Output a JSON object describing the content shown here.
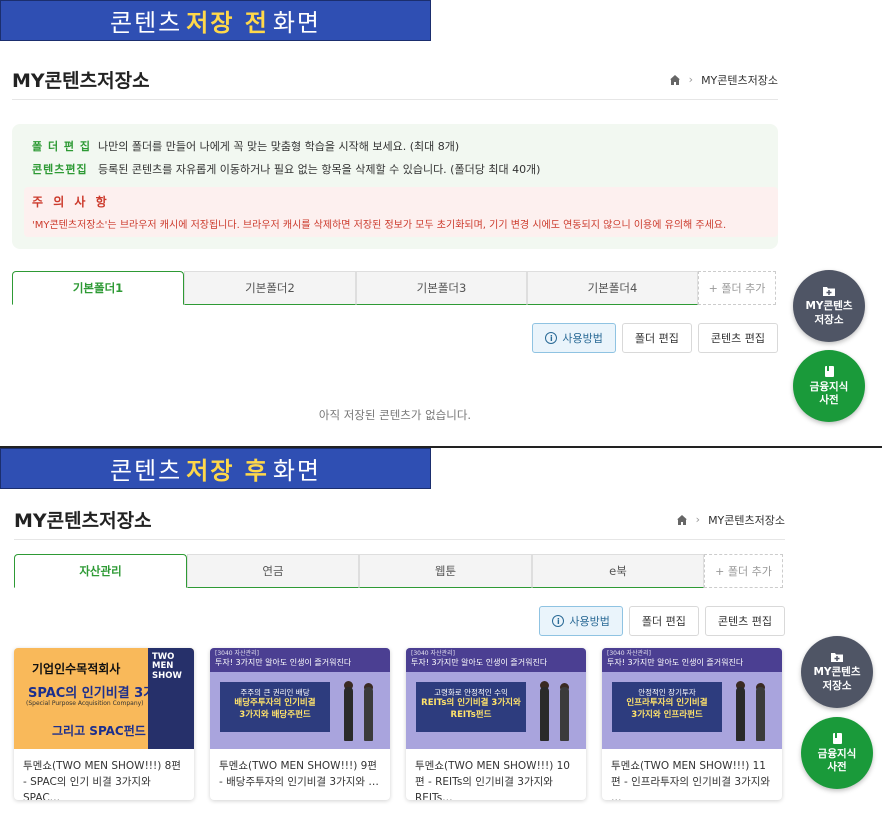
{
  "banners": {
    "top": {
      "pre": "콘텐츠",
      "highlight": "저장 전",
      "post": "화면"
    },
    "bottom": {
      "pre": "콘텐츠",
      "highlight": "저장 후",
      "post": "화면"
    }
  },
  "colors": {
    "banner_bg": "#2f4fb3",
    "banner_highlight": "#ffd84a",
    "accent_green": "#2e9a35",
    "caution_red": "#cc3a2c",
    "fab_dark": "#4f5565",
    "fab_green": "#1a9a3a"
  },
  "before": {
    "title": "MY콘텐츠저장소",
    "breadcrumb": {
      "home_icon": "home-icon",
      "current": "MY콘텐츠저장소"
    },
    "info": {
      "folder_label": "폴 더 편 집",
      "folder_text": "나만의 폴더를 만들어 나에게 꼭 맞는 맞춤형 학습을 시작해 보세요. (최대 8개)",
      "content_label": "콘텐츠편집",
      "content_text": "등록된 콘텐츠를 자유롭게 이동하거나 필요 없는 항목을 삭제할 수 있습니다. (폴더당 최대 40개)",
      "caution_title": "주 의 사 항",
      "caution_text": "'MY콘텐츠저장소'는 브라우저 캐시에 저장됩니다. 브라우저 캐시를 삭제하면 저장된 정보가 모두 초기화되며, 기기 변경 시에도 연동되지 않으니 이용에 유의해 주세요."
    },
    "tabs": [
      "기본폴더1",
      "기본폴더2",
      "기본폴더3",
      "기본폴더4"
    ],
    "add_tab": "+ 폴더 추가",
    "buttons": {
      "howto": "사용방법",
      "folder_edit": "폴더 편집",
      "content_edit": "콘텐츠 편집"
    },
    "empty_text": "아직 저장된 콘텐츠가 없습니다."
  },
  "after": {
    "title": "MY콘텐츠저장소",
    "breadcrumb": {
      "home_icon": "home-icon",
      "current": "MY콘텐츠저장소"
    },
    "tabs": [
      "자산관리",
      "연금",
      "웹툰",
      "e북"
    ],
    "add_tab": "+ 폴더 추가",
    "buttons": {
      "howto": "사용방법",
      "folder_edit": "폴더 편집",
      "content_edit": "콘텐츠 편집"
    },
    "cards": [
      {
        "title": "투멘쇼(TWO MEN SHOW!!!) 8편 - SPAC의 인기 비결 3가지와 SPAC…",
        "thumb": {
          "l1": "기업인수목적회사",
          "l2": "SPAC의 인기비결 3가지,",
          "l3": "(Special Purpose Acquisition Company)",
          "l4": "그리고 SPAC펀드",
          "side": "TWO MEN SHOW"
        }
      },
      {
        "title": "투멘쇼(TWO MEN SHOW!!!) 9편 - 배당주투자의 인기비결 3가지와 …",
        "thumb": {
          "tag": "[3040 자산관리]",
          "bar": "투자! 3가지만 알아도 인생이 즐거워진다",
          "b1": "주주의 큰 권리인 배당",
          "b2": "배당주투자의 인기비결",
          "b3": "3가지와 배당주펀드"
        }
      },
      {
        "title": "투멘쇼(TWO MEN SHOW!!!) 10편 - REITs의 인기비결 3가지와 REITs…",
        "thumb": {
          "tag": "[3040 자산관리]",
          "bar": "투자! 3가지만 알아도 인생이 즐거워진다",
          "b1": "고령화로 안정적인 수익",
          "b2": "REITs의 인기비결 3가지와",
          "b3": "REITs펀드"
        }
      },
      {
        "title": "투멘쇼(TWO MEN SHOW!!!) 11편 - 인프라투자의 인기비결 3가지와 …",
        "thumb": {
          "tag": "[3040 자산관리]",
          "bar": "투자! 3가지만 알아도 인생이 즐거워진다",
          "b1": "안정적인 장기투자",
          "b2": "인프라투자의 인기비결",
          "b3": "3가지와 인프라펀드"
        }
      }
    ]
  },
  "fabs": {
    "my_storage": {
      "line1": "MY콘텐츠",
      "line2": "저장소",
      "icon": "folder-plus-icon"
    },
    "dictionary": {
      "line1": "금융지식",
      "line2": "사전",
      "icon": "book-icon"
    }
  }
}
